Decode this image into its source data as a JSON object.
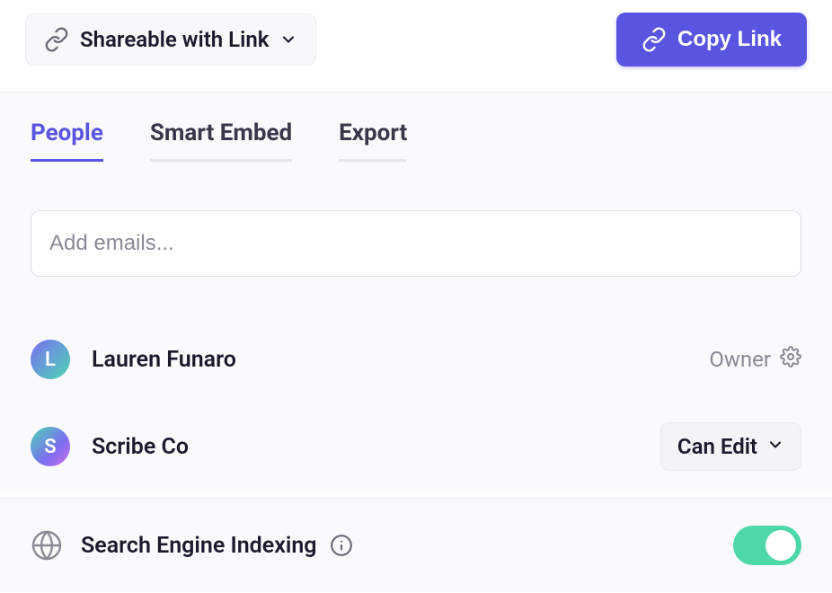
{
  "header": {
    "share_mode": "Shareable with Link",
    "copy_button": "Copy Link"
  },
  "tabs": {
    "people": "People",
    "smart_embed": "Smart Embed",
    "export": "Export"
  },
  "email_input": {
    "placeholder": "Add emails..."
  },
  "people": [
    {
      "initial": "L",
      "name": "Lauren Funaro",
      "role": "Owner"
    },
    {
      "initial": "S",
      "name": "Scribe Co",
      "role": "Can Edit"
    }
  ],
  "footer": {
    "indexing_label": "Search Engine Indexing",
    "indexing_enabled": true
  }
}
